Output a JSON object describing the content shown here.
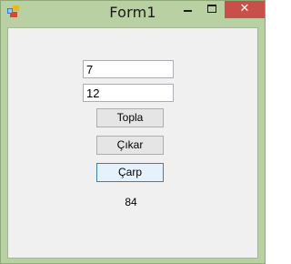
{
  "window": {
    "title": "Form1",
    "close_glyph": "✕",
    "accent_color": "#c7504b",
    "frame_color": "#b9d1a2",
    "icons": [
      "app-icon",
      "minimize-icon",
      "maximize-icon",
      "close-icon"
    ]
  },
  "form": {
    "input1_value": "7",
    "input2_value": "12",
    "buttons": {
      "add": "Topla",
      "subtract": "Çıkar",
      "multiply": "Çarp"
    },
    "result": "84"
  }
}
